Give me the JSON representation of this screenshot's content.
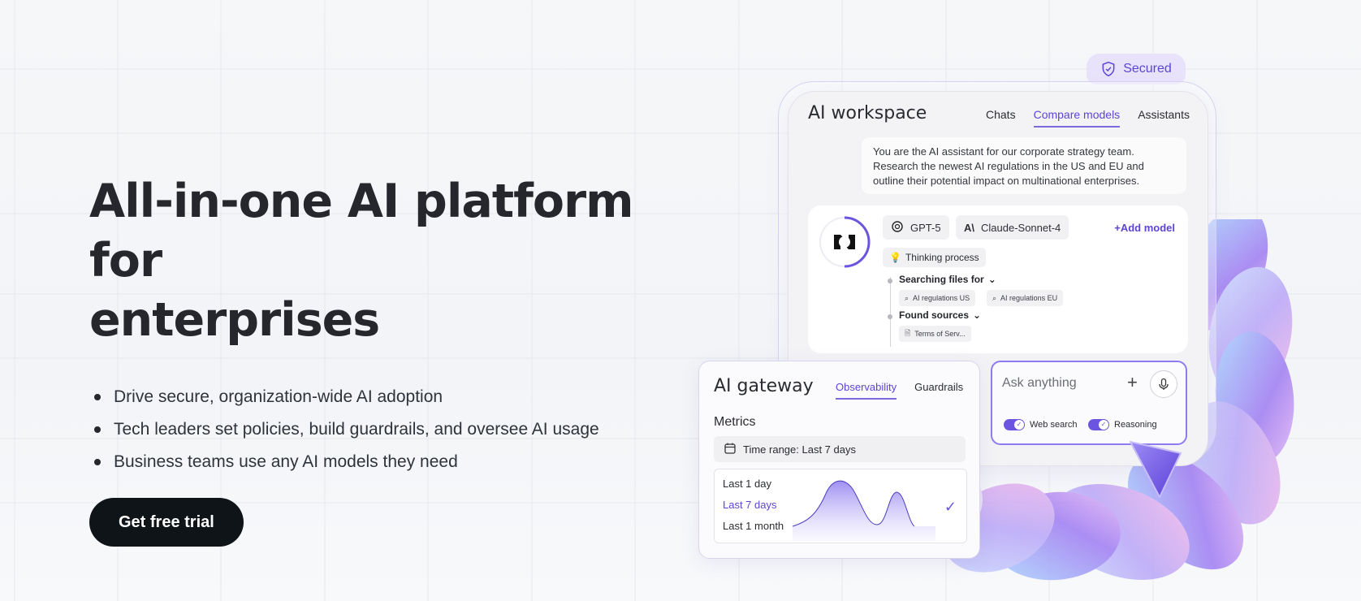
{
  "hero": {
    "title_line1": "All-in-one AI platform for",
    "title_line2": "enterprises",
    "bullets": [
      "Drive secure, organization-wide AI adoption",
      "Tech leaders set policies, build guardrails, and oversee AI usage",
      "Business teams use any AI models they need"
    ],
    "cta_label": "Get free trial"
  },
  "badge": {
    "label": "Secured",
    "icon": "shield-check-icon"
  },
  "workspace": {
    "title": "AI workspace",
    "tabs": [
      "Chats",
      "Compare models",
      "Assistants"
    ],
    "active_tab": "Compare models",
    "prompt": "You are the AI assistant for our corporate strategy team. Research the newest AI regulations in the US and EU and outline their potential impact on multinational enterprises.",
    "models": [
      {
        "name": "GPT-5",
        "icon": "openai-icon"
      },
      {
        "name": "Claude-Sonnet-4",
        "icon": "anthropic-icon"
      }
    ],
    "add_model": "+Add model",
    "thinking": "Thinking process",
    "steps": [
      {
        "label": "Searching files for",
        "chips": [
          "AI regulations US",
          "AI regulations EU"
        ]
      },
      {
        "label": "Found sources",
        "chips": [
          "Terms of Serv..."
        ]
      }
    ]
  },
  "gateway": {
    "title": "AI gateway",
    "tabs": [
      "Observability",
      "Guardrails"
    ],
    "active_tab": "Observability",
    "metrics_label": "Metrics",
    "time_range": "Time range: Last 7 days",
    "options": [
      "Last 1 day",
      "Last 7 days",
      "Last 1 month"
    ],
    "selected_option": "Last 7 days"
  },
  "ask": {
    "placeholder": "Ask anything",
    "toggles": [
      {
        "label": "Web search",
        "on": true
      },
      {
        "label": "Reasoning",
        "on": true
      }
    ]
  },
  "colors": {
    "accent": "#5b45d6",
    "cta_bg": "#0f1419",
    "text": "#25272c"
  }
}
